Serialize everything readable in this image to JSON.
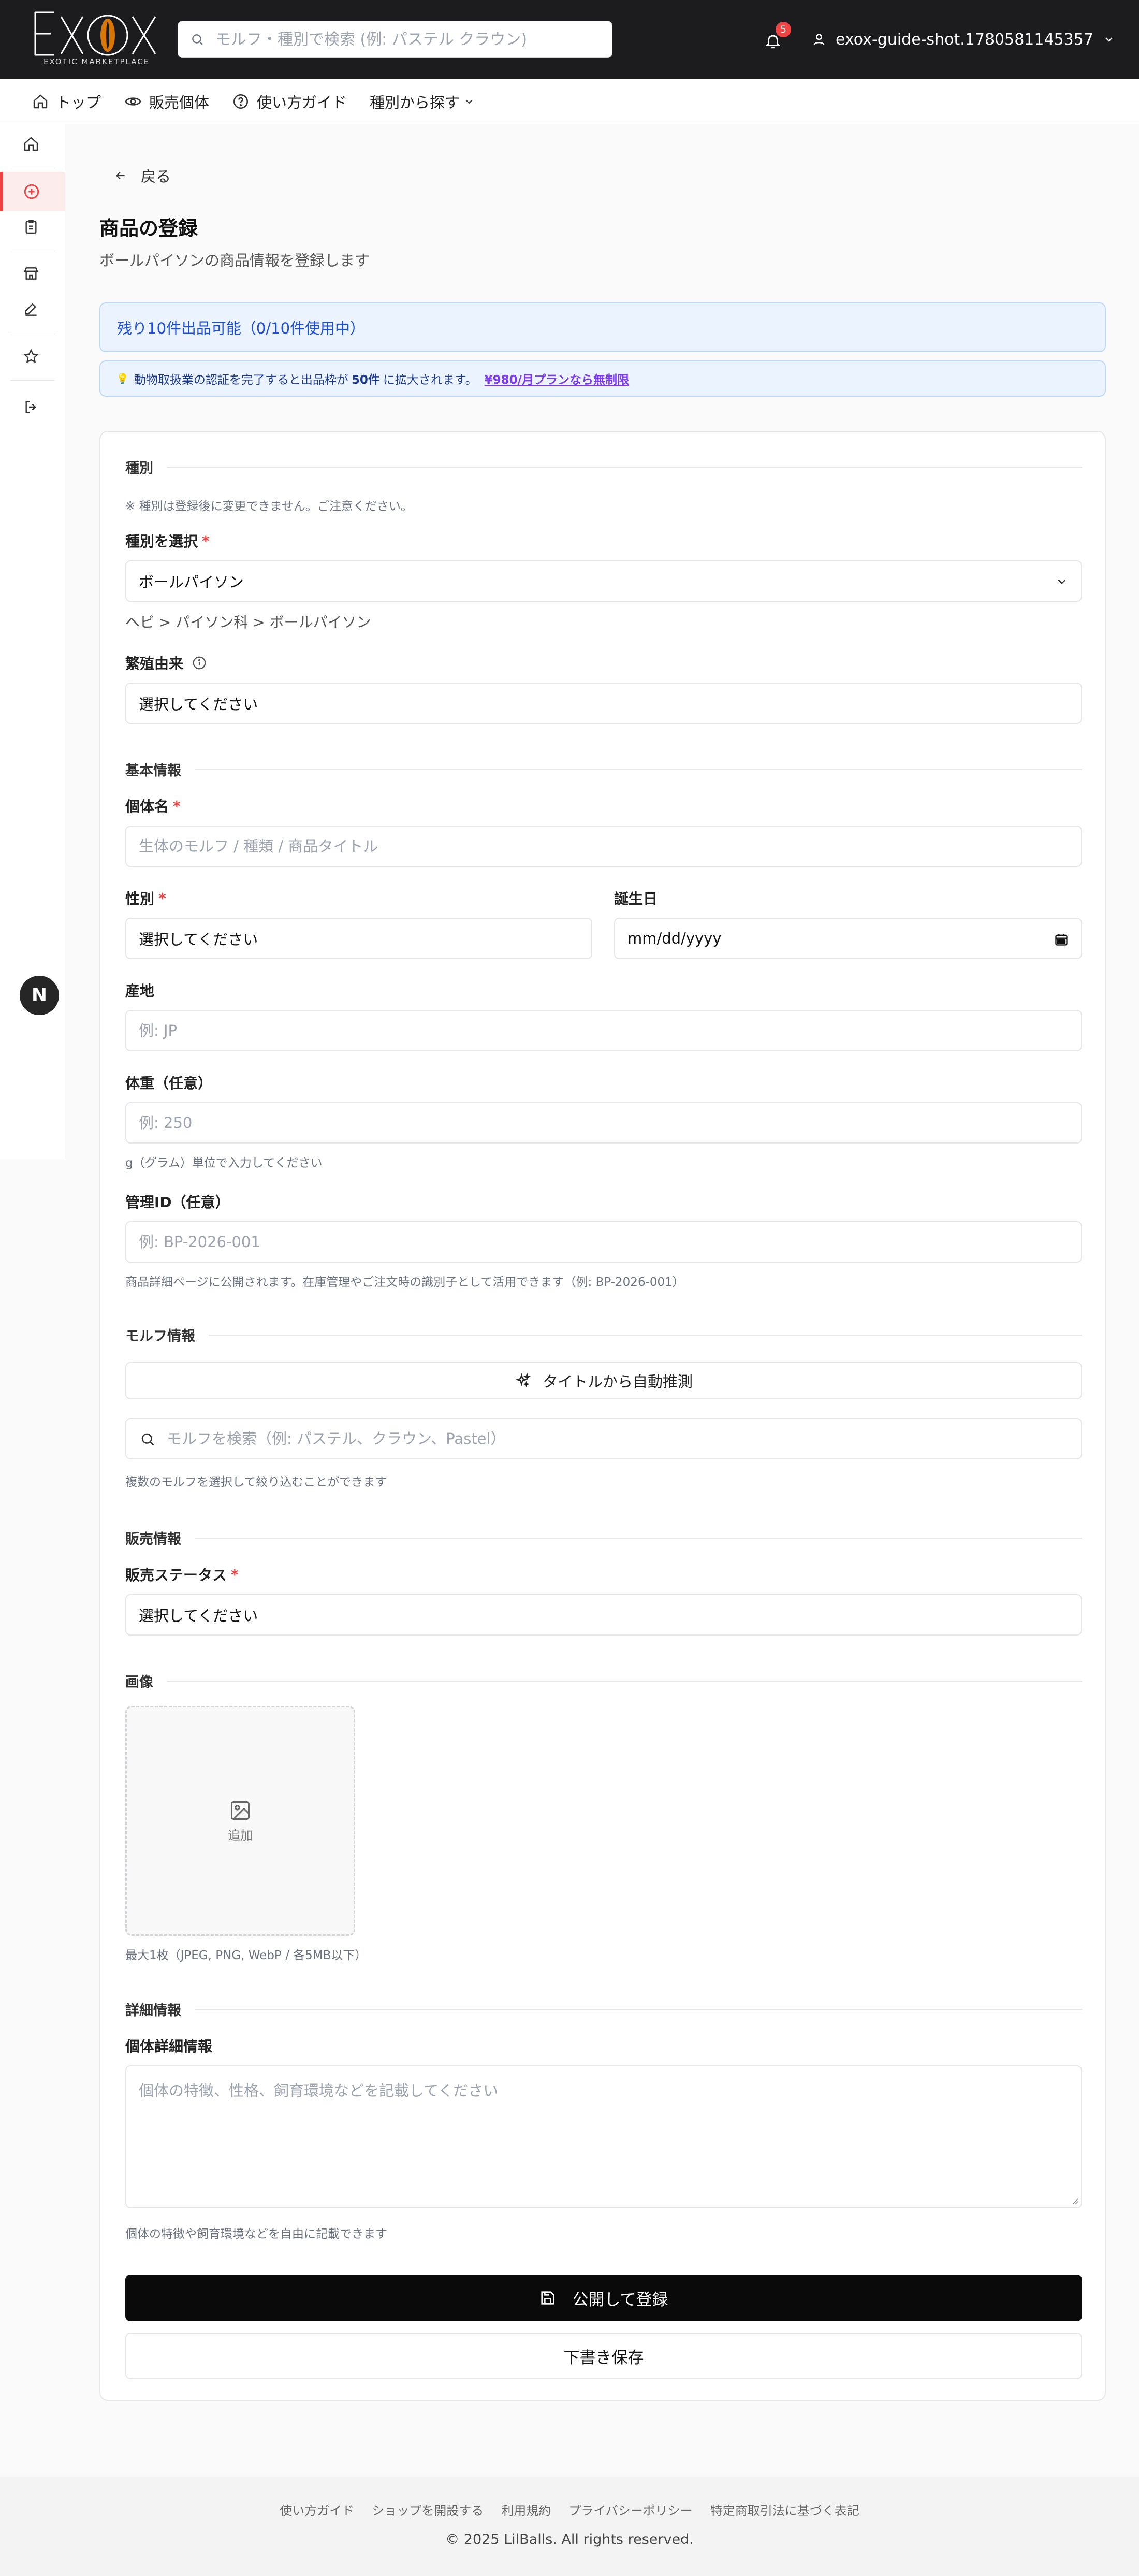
{
  "header": {
    "logo_text": "EXOX",
    "logo_subtitle": "EXOTIC MARKETPLACE",
    "search_placeholder": "モルフ・種別で検索 (例: パステル クラウン)",
    "notification_count": "5",
    "username": "exox-guide-shot.1780581145357"
  },
  "nav": {
    "items": [
      {
        "label": "トップ",
        "icon": "home-icon"
      },
      {
        "label": "販売個体",
        "icon": "eye-icon"
      },
      {
        "label": "使い方ガイド",
        "icon": "help-circle-icon"
      },
      {
        "label": "種別から探す",
        "icon": "chevron-down-icon"
      }
    ]
  },
  "sidebar": {
    "items": [
      {
        "icon": "home-icon"
      },
      {
        "icon": "plus-circle-icon",
        "active": true
      },
      {
        "icon": "clipboard-icon"
      },
      {
        "icon": "store-icon"
      },
      {
        "icon": "edit-icon"
      },
      {
        "icon": "star-icon"
      },
      {
        "icon": "logout-icon"
      }
    ]
  },
  "dev_badge": "N",
  "page": {
    "back_label": "戻る",
    "title": "商品の登録",
    "subtitle": "ボールパイソンの商品情報を登録します",
    "quota_text": "残り10件出品可能（0/10件使用中）",
    "notice": {
      "emoji": "💡",
      "pre": "動物取扱業の認証を完了すると出品枠が",
      "bold": "50件",
      "post": "に拡大されます。",
      "link": "¥980/月プランなら無制限"
    }
  },
  "form": {
    "species_section": "種別",
    "species_note": "※ 種別は登録後に変更できません。ご注意ください。",
    "species_label": "種別を選択",
    "species_value": "ボールパイソン",
    "species_path": "ヘビ > パイソン科 > ボールパイソン",
    "origin_label": "繁殖由来",
    "origin_value": "選択してください",
    "basic_section": "基本情報",
    "name_label": "個体名",
    "name_placeholder": "生体のモルフ / 種類 / 商品タイトル",
    "sex_label": "性別",
    "sex_value": "選択してください",
    "birthday_label": "誕生日",
    "birthday_value": "mm/dd/yyyy",
    "locality_label": "産地",
    "locality_placeholder": "例: JP",
    "weight_label": "体重（任意）",
    "weight_placeholder": "例: 250",
    "weight_hint": "g（グラム）単位で入力してください",
    "mgmt_label": "管理ID（任意）",
    "mgmt_placeholder": "例: BP-2026-001",
    "mgmt_hint": "商品詳細ページに公開されます。在庫管理やご注文時の識別子として活用できます（例: BP-2026-001）",
    "morph_section": "モルフ情報",
    "auto_guess_label": "タイトルから自動推測",
    "morph_search_placeholder": "モルフを検索（例: パステル、クラウン、Pastel）",
    "morph_hint": "複数のモルフを選択して絞り込むことができます",
    "sales_section": "販売情報",
    "status_label": "販売ステータス",
    "status_value": "選択してください",
    "image_section": "画像",
    "image_add_label": "追加",
    "image_hint": "最大1枚（JPEG, PNG, WebP / 各5MB以下）",
    "detail_section": "詳細情報",
    "detail_label": "個体詳細情報",
    "detail_placeholder": "個体の特徴、性格、飼育環境などを記載してください",
    "detail_hint": "個体の特徴や飼育環境などを自由に記載できます",
    "publish_label": "公開して登録",
    "draft_label": "下書き保存"
  },
  "footer": {
    "links": [
      "使い方ガイド",
      "ショップを開設する",
      "利用規約",
      "プライバシーポリシー",
      "特定商取引法に基づく表記"
    ],
    "copyright": "© 2025 LilBalls. All rights reserved."
  }
}
